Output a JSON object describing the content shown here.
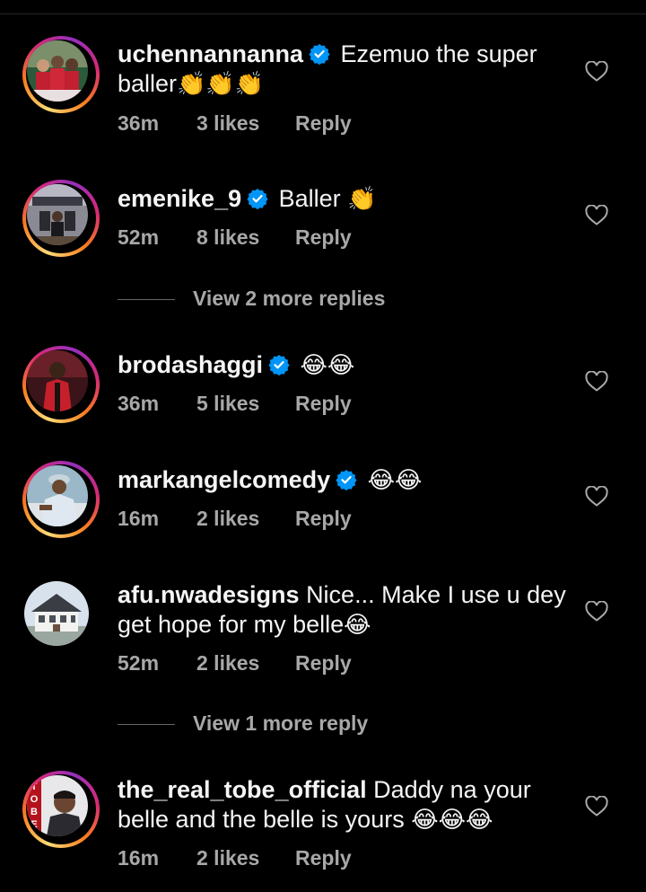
{
  "comments": [
    {
      "username": "uchennannanna",
      "verified": true,
      "text": "Ezemuo the super",
      "text2": "baller",
      "emoji": "👏👏👏",
      "time": "36m",
      "likes": "3 likes",
      "reply": "Reply"
    },
    {
      "username": "emenike_9",
      "verified": true,
      "text": "Baller",
      "emoji": "👏",
      "time": "52m",
      "likes": "8 likes",
      "reply": "Reply"
    },
    {
      "username": "brodashaggi",
      "verified": true,
      "emoji": "😂😂",
      "time": "36m",
      "likes": "5 likes",
      "reply": "Reply"
    },
    {
      "username": "markangelcomedy",
      "verified": true,
      "emoji": "😂😂",
      "time": "16m",
      "likes": "2 likes",
      "reply": "Reply"
    },
    {
      "username": "afu.nwadesigns",
      "verified": false,
      "text": "Nice... Make I use u dey",
      "text2": "get hope for my belle",
      "emoji": "😂",
      "time": "52m",
      "likes": "2 likes",
      "reply": "Reply"
    },
    {
      "username": "the_real_tobe_official",
      "verified": false,
      "text": "Daddy na your",
      "text2": "belle and the belle is yours",
      "emoji": "😂😂😂",
      "time": "16m",
      "likes": "2 likes",
      "reply": "Reply"
    }
  ],
  "view_more_1": "View 2 more replies",
  "view_more_2": "View 1 more reply",
  "avatar_logo_text": "TOBE",
  "colors": {
    "background": "#000000",
    "text": "#f5f5f5",
    "secondary": "#a8a8a8",
    "verified": "#0095f6"
  },
  "icons": [
    "verified-badge-icon",
    "heart-outline-icon"
  ]
}
